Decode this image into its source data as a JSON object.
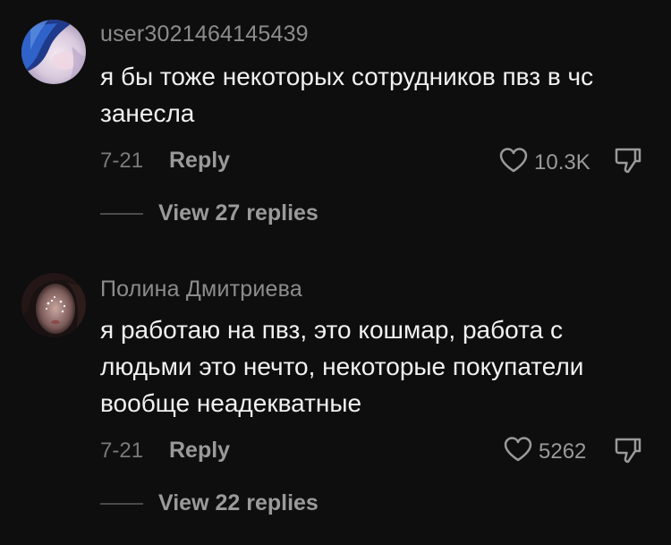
{
  "comments": [
    {
      "username": "user3021464145439",
      "text": "я бы тоже некоторых сотрудников пвз в чс занесла",
      "date": "7-21",
      "reply_label": "Reply",
      "likes": "10.3K",
      "view_replies": "View 27 replies",
      "avatar_icon": "user-avatar-blue-hair"
    },
    {
      "username": "Полина Дмитриева",
      "text": "я работаю на пвз, это кошмар, работа с людьми это нечто, некоторые покупатели вообще неадекватные",
      "date": "7-21",
      "reply_label": "Reply",
      "likes": "5262",
      "view_replies": "View 22 replies",
      "avatar_icon": "user-avatar-photo"
    }
  ],
  "icons": {
    "like": "heart-outline-icon",
    "dislike": "thumbs-down-icon"
  },
  "colors": {
    "background": "#0e0e0e",
    "text": "#f1f1f1",
    "muted": "#8c8c8c"
  }
}
